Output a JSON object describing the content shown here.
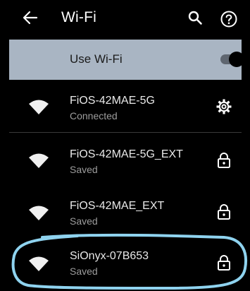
{
  "header": {
    "title": "Wi-Fi",
    "back_icon": "back-arrow-icon",
    "search_icon": "search-icon",
    "help_icon": "help-icon"
  },
  "use_wifi": {
    "label": "Use Wi-Fi",
    "enabled": true,
    "background_color": "#a9b5c3"
  },
  "networks": [
    {
      "name": "FiOS-42MAE-5G",
      "status": "Connected",
      "action_icon": "gear-icon"
    },
    {
      "name": "FiOS-42MAE-5G_EXT",
      "status": "Saved",
      "action_icon": "lock-icon"
    },
    {
      "name": "FiOS-42MAE_EXT",
      "status": "Saved",
      "action_icon": "lock-icon"
    },
    {
      "name": "SiOnyx-07B653",
      "status": "Saved",
      "action_icon": "lock-icon"
    }
  ],
  "colors": {
    "highlight_stroke": "#8fd3ef",
    "text_primary": "#e9e9e9",
    "text_secondary": "#9c9c9c"
  }
}
